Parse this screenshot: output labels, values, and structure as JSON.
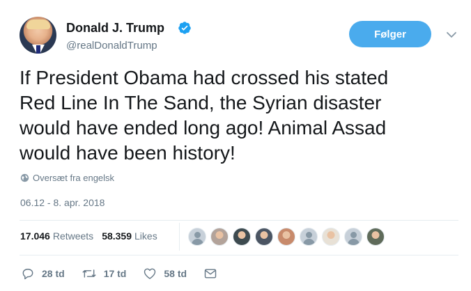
{
  "author": {
    "name": "Donald J. Trump",
    "handle": "@realDonaldTrump",
    "verified": true
  },
  "follow_button": {
    "label": "Følger",
    "color": "#4aabed"
  },
  "tweet": {
    "lines": [
      "If President Obama had crossed his stated",
      "Red Line In The Sand, the Syrian disaster",
      "would have ended long ago! Animal Assad",
      "would have been history!"
    ]
  },
  "translate": {
    "label": "Oversæt fra engelsk",
    "icon": "globe-icon"
  },
  "timestamp": "06.12 - 8. apr. 2018",
  "stats": {
    "retweets": {
      "count": "17.046",
      "label": "Retweets"
    },
    "likes": {
      "count": "58.359",
      "label": "Likes"
    }
  },
  "likers": [
    {
      "style": "default"
    },
    {
      "style": "photo",
      "color": "#b3a39a"
    },
    {
      "style": "photo",
      "color": "#3d4a4f"
    },
    {
      "style": "photo",
      "color": "#4b5563"
    },
    {
      "style": "photo",
      "color": "#c88a6b"
    },
    {
      "style": "default"
    },
    {
      "style": "photo",
      "color": "#e8e1d6"
    },
    {
      "style": "default"
    },
    {
      "style": "photo",
      "color": "#5f6b5a"
    }
  ],
  "actions": {
    "reply": {
      "count": "28 td",
      "icon": "reply-icon"
    },
    "retweet": {
      "count": "17 td",
      "icon": "retweet-icon"
    },
    "like": {
      "count": "58 td",
      "icon": "heart-icon"
    },
    "message": {
      "icon": "envelope-icon"
    }
  },
  "colors": {
    "text": "#14171a",
    "muted": "#657786",
    "accent": "#1da1f2",
    "divider": "#e6ecf0"
  }
}
